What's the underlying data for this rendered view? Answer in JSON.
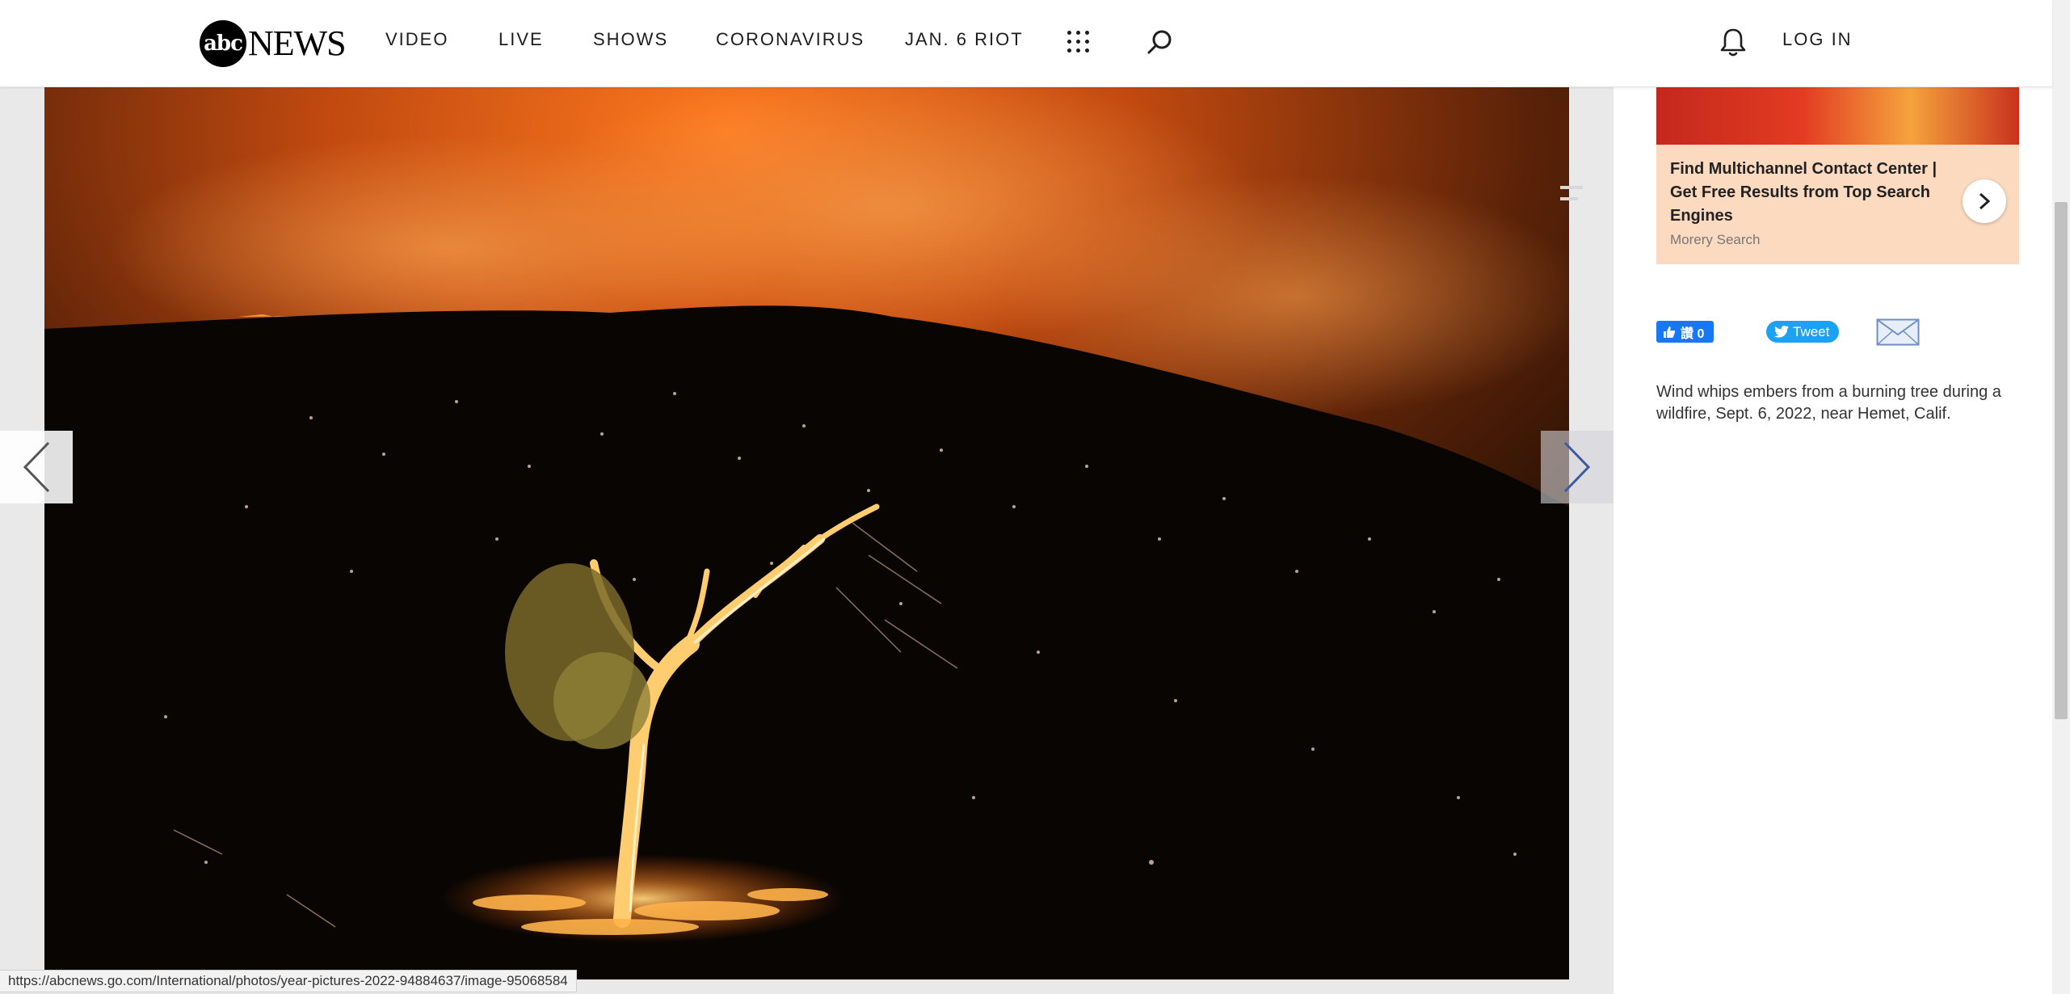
{
  "nav": {
    "logo_abc": "abc",
    "logo_news": "NEWS",
    "items": [
      "VIDEO",
      "LIVE",
      "SHOWS",
      "CORONAVIRUS",
      "JAN. 6 RIOT"
    ],
    "login": "LOG IN"
  },
  "ad": {
    "title": "Find Multichannel Contact Center | Get Free Results from Top Search Engines",
    "source": "Morery Search"
  },
  "share": {
    "like_label": "讚 0",
    "tweet_label": "Tweet"
  },
  "caption": "Wind whips embers from a burning tree during a wildfire, Sept. 6, 2022, near Hemet, Calif.",
  "status_url": "https://abcnews.go.com/International/photos/year-pictures-2022-94884637/image-95068584",
  "colors": {
    "facebook": "#1877f2",
    "twitter": "#1da1f2",
    "fire": "#e0651c"
  }
}
